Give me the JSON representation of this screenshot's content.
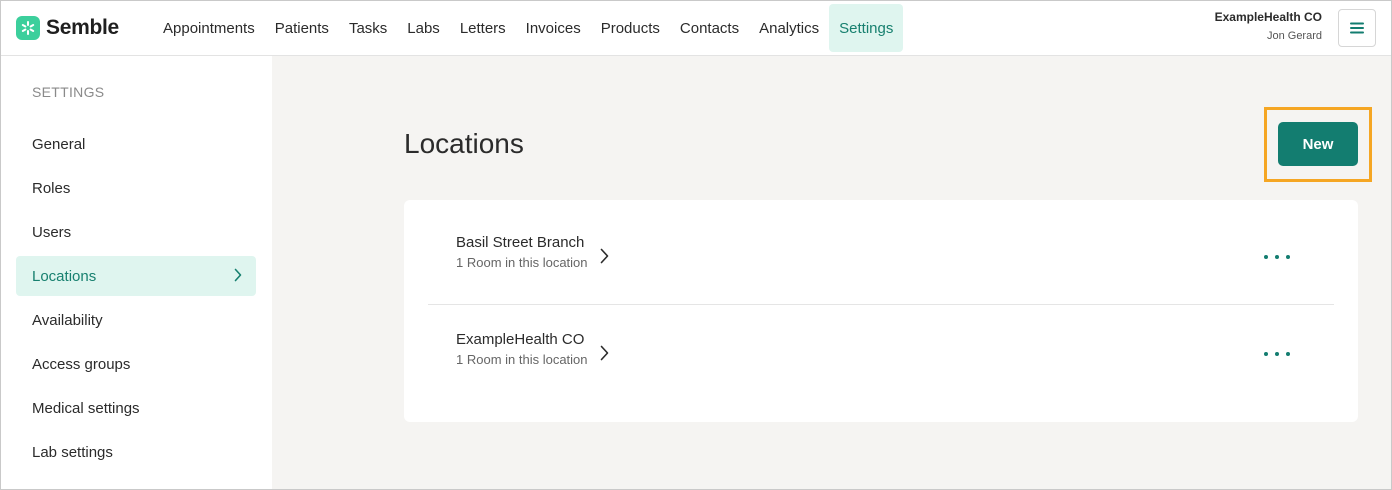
{
  "app": {
    "name": "Semble",
    "logo_icon": "semble-logo-icon",
    "brand_color": "#3ccf9c",
    "accent_color": "#137d70"
  },
  "nav": {
    "items": [
      {
        "label": "Appointments"
      },
      {
        "label": "Patients"
      },
      {
        "label": "Tasks"
      },
      {
        "label": "Labs"
      },
      {
        "label": "Letters"
      },
      {
        "label": "Invoices"
      },
      {
        "label": "Products"
      },
      {
        "label": "Contacts"
      },
      {
        "label": "Analytics"
      },
      {
        "label": "Settings",
        "active": true
      }
    ]
  },
  "account": {
    "organization": "ExampleHealth CO",
    "user": "Jon Gerard",
    "menu_icon": "hamburger-menu-icon"
  },
  "sidebar": {
    "heading": "SETTINGS",
    "items": [
      {
        "label": "General"
      },
      {
        "label": "Roles"
      },
      {
        "label": "Users"
      },
      {
        "label": "Locations",
        "active": true
      },
      {
        "label": "Availability"
      },
      {
        "label": "Access groups"
      },
      {
        "label": "Medical settings"
      },
      {
        "label": "Lab settings"
      }
    ]
  },
  "main": {
    "title": "Locations",
    "new_button_label": "New",
    "highlight_color": "#f5a623",
    "locations": [
      {
        "name": "Basil Street Branch",
        "rooms": "1 Room in this location"
      },
      {
        "name": "ExampleHealth CO",
        "rooms": "1 Room in this location"
      }
    ]
  }
}
